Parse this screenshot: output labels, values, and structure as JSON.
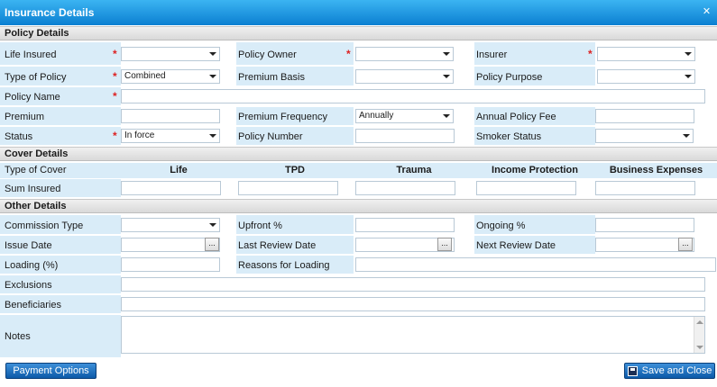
{
  "window": {
    "title": "Insurance Details",
    "close_glyph": "✕"
  },
  "sections": {
    "policy": "Policy Details",
    "cover": "Cover Details",
    "other": "Other Details"
  },
  "policy": {
    "life_insured": "Life Insured",
    "policy_owner": "Policy Owner",
    "insurer": "Insurer",
    "type_of_policy": "Type of Policy",
    "type_of_policy_value": "Combined",
    "premium_basis": "Premium Basis",
    "policy_purpose": "Policy Purpose",
    "policy_name": "Policy Name",
    "premium": "Premium",
    "premium_frequency": "Premium Frequency",
    "premium_frequency_value": "Annually",
    "annual_policy_fee": "Annual Policy Fee",
    "status": "Status",
    "status_value": "In force",
    "policy_number": "Policy Number",
    "smoker_status": "Smoker Status",
    "required_mark": "*"
  },
  "cover": {
    "type_of_cover": "Type of Cover",
    "sum_insured": "Sum Insured",
    "columns": [
      "Life",
      "TPD",
      "Trauma",
      "Income Protection",
      "Business Expenses"
    ]
  },
  "other": {
    "commission_type": "Commission Type",
    "upfront": "Upfront %",
    "ongoing": "Ongoing %",
    "issue_date": "Issue Date",
    "last_review_date": "Last Review Date",
    "next_review_date": "Next Review Date",
    "loading": "Loading (%)",
    "reasons_for_loading": "Reasons for Loading",
    "exclusions": "Exclusions",
    "beneficiaries": "Beneficiaries",
    "notes": "Notes",
    "picker_label": "..."
  },
  "footer": {
    "payment_options": "Payment Options",
    "save_and_close": "Save and Close"
  },
  "icons": {
    "close": "close-icon",
    "save": "save-disk-icon",
    "dropdown": "chevron-down-icon"
  }
}
